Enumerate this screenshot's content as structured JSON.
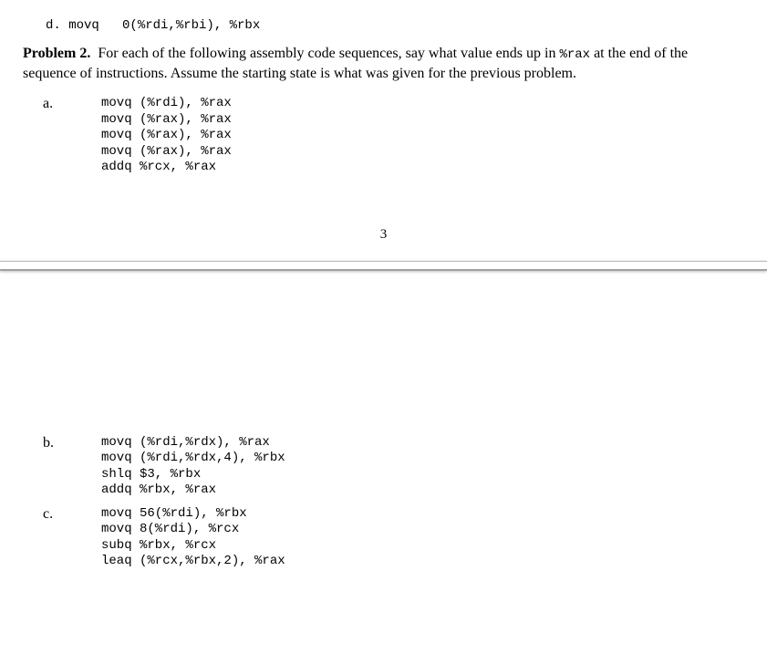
{
  "cutoff": "d. movq   0(%rdi,%rbi), %rbx",
  "problem": {
    "title_prefix": "Problem 2.",
    "body_before_code": "For each of the following assembly code sequences, say what value ends up in ",
    "code_inline": "%rax",
    "body_after_code": " at the end of the sequence of instructions. Assume the starting state is what was given for the previous problem."
  },
  "items": {
    "a": {
      "label": "a.",
      "code": "movq (%rdi), %rax\nmovq (%rax), %rax\nmovq (%rax), %rax\nmovq (%rax), %rax\naddq %rcx, %rax"
    },
    "b": {
      "label": "b.",
      "code": "movq (%rdi,%rdx), %rax\nmovq (%rdi,%rdx,4), %rbx\nshlq $3, %rbx\naddq %rbx, %rax"
    },
    "c": {
      "label": "c.",
      "code": "movq 56(%rdi), %rbx\nmovq 8(%rdi), %rcx\nsubq %rbx, %rcx\nleaq (%rcx,%rbx,2), %rax"
    }
  },
  "page_number": "3"
}
